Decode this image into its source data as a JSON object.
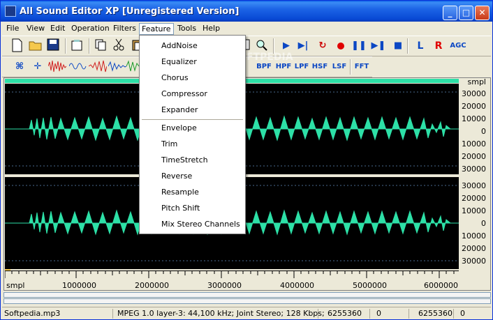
{
  "window": {
    "title": "All Sound Editor XP [Unregistered Version]"
  },
  "menubar": [
    "File",
    "View",
    "Edit",
    "Operation",
    "Filters",
    "Feature",
    "Tools",
    "Help"
  ],
  "feature_menu": {
    "group1": [
      "AddNoise",
      "Equalizer",
      "Chorus",
      "Compressor",
      "Expander"
    ],
    "group2": [
      "Envelope",
      "Trim",
      "TimeStretch",
      "Reverse",
      "Resample",
      "Pitch Shift",
      "Mix Stereo Channels"
    ]
  },
  "toolbar_text": {
    "agc": "AGC",
    "l": "L",
    "r": "R",
    "bpf": "BPF",
    "hpf": "HPF",
    "lpf": "LPF",
    "hsf": "HSF",
    "lsf": "LSF",
    "fft": "FFT"
  },
  "scale": {
    "unit": "smpl",
    "labels": [
      "30000",
      "20000",
      "10000",
      "0",
      "10000",
      "20000",
      "30000"
    ]
  },
  "ruler": {
    "unit": "smpl",
    "labels": [
      "1000000",
      "2000000",
      "3000000",
      "4000000",
      "5000000",
      "6000000"
    ]
  },
  "status": {
    "file": "Softpedia.mp3",
    "format": "MPEG 1.0 layer-3: 44,100 kHz; Joint Stereo; 128 Kbps;",
    "total": "6255360",
    "sel_start": "0",
    "sel_end": "6255360",
    "extra": "0"
  },
  "colors": {
    "waveform": "#2de0a7",
    "background": "#000000"
  },
  "watermark": "SOFTPEDIA"
}
